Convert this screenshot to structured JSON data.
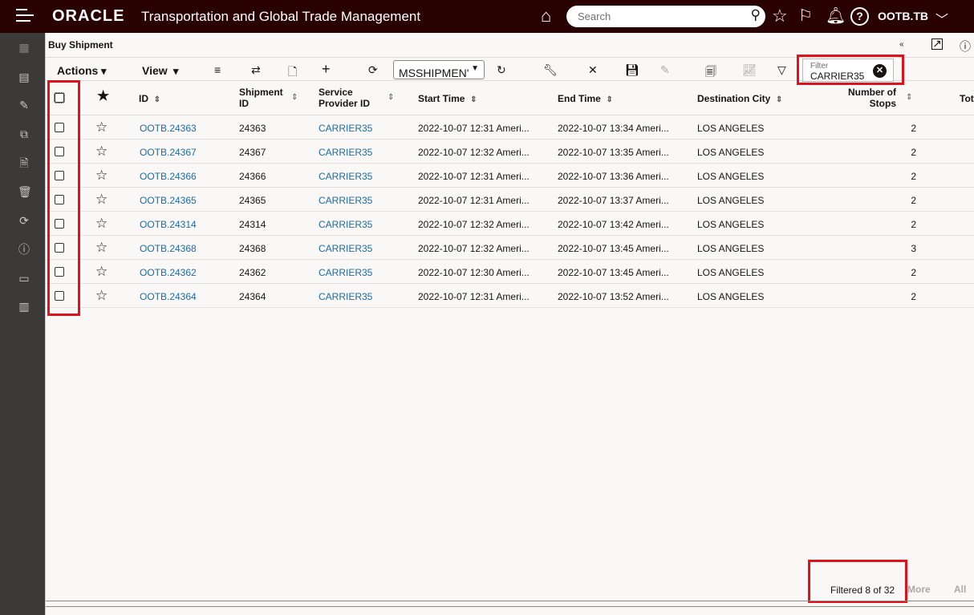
{
  "header": {
    "logo": "ORACLE",
    "app_title": "Transportation and Global Trade Management",
    "search_placeholder": "Search",
    "user": "OOTB.TB"
  },
  "page": {
    "title": "Buy Shipment"
  },
  "toolbar": {
    "actions": "Actions",
    "view": "View",
    "saved_query": "MSSHIPMEN'",
    "filter_label": "Filter",
    "filter_value": "CARRIER35"
  },
  "columns": [
    "ID",
    "Shipment ID",
    "Service Provider ID",
    "Start Time",
    "End Time",
    "Destination City",
    "Number of Stops",
    "Tota"
  ],
  "rows": [
    {
      "id": "OOTB.24363",
      "shipment_id": "24363",
      "provider": "CARRIER35",
      "start": "2022-10-07 12:31 Ameri...",
      "end": "2022-10-07 13:34 Ameri...",
      "city": "LOS ANGELES",
      "stops": "2"
    },
    {
      "id": "OOTB.24367",
      "shipment_id": "24367",
      "provider": "CARRIER35",
      "start": "2022-10-07 12:32 Ameri...",
      "end": "2022-10-07 13:35 Ameri...",
      "city": "LOS ANGELES",
      "stops": "2"
    },
    {
      "id": "OOTB.24366",
      "shipment_id": "24366",
      "provider": "CARRIER35",
      "start": "2022-10-07 12:31 Ameri...",
      "end": "2022-10-07 13:36 Ameri...",
      "city": "LOS ANGELES",
      "stops": "2"
    },
    {
      "id": "OOTB.24365",
      "shipment_id": "24365",
      "provider": "CARRIER35",
      "start": "2022-10-07 12:31 Ameri...",
      "end": "2022-10-07 13:37 Ameri...",
      "city": "LOS ANGELES",
      "stops": "2"
    },
    {
      "id": "OOTB.24314",
      "shipment_id": "24314",
      "provider": "CARRIER35",
      "start": "2022-10-07 12:32 Ameri...",
      "end": "2022-10-07 13:42 Ameri...",
      "city": "LOS ANGELES",
      "stops": "2"
    },
    {
      "id": "OOTB.24368",
      "shipment_id": "24368",
      "provider": "CARRIER35",
      "start": "2022-10-07 12:32 Ameri...",
      "end": "2022-10-07 13:45 Ameri...",
      "city": "LOS ANGELES",
      "stops": "3"
    },
    {
      "id": "OOTB.24362",
      "shipment_id": "24362",
      "provider": "CARRIER35",
      "start": "2022-10-07 12:30 Ameri...",
      "end": "2022-10-07 13:45 Ameri...",
      "city": "LOS ANGELES",
      "stops": "2"
    },
    {
      "id": "OOTB.24364",
      "shipment_id": "24364",
      "provider": "CARRIER35",
      "start": "2022-10-07 12:31 Ameri...",
      "end": "2022-10-07 13:52 Ameri...",
      "city": "LOS ANGELES",
      "stops": "2"
    }
  ],
  "footer": {
    "status": "Filtered 8 of 32",
    "more": "More",
    "all": "All"
  },
  "colors": {
    "header_bg": "#2a0101",
    "sidebar_bg": "#3b3a39",
    "link": "#1f6aa0",
    "highlight": "#e0121c"
  }
}
